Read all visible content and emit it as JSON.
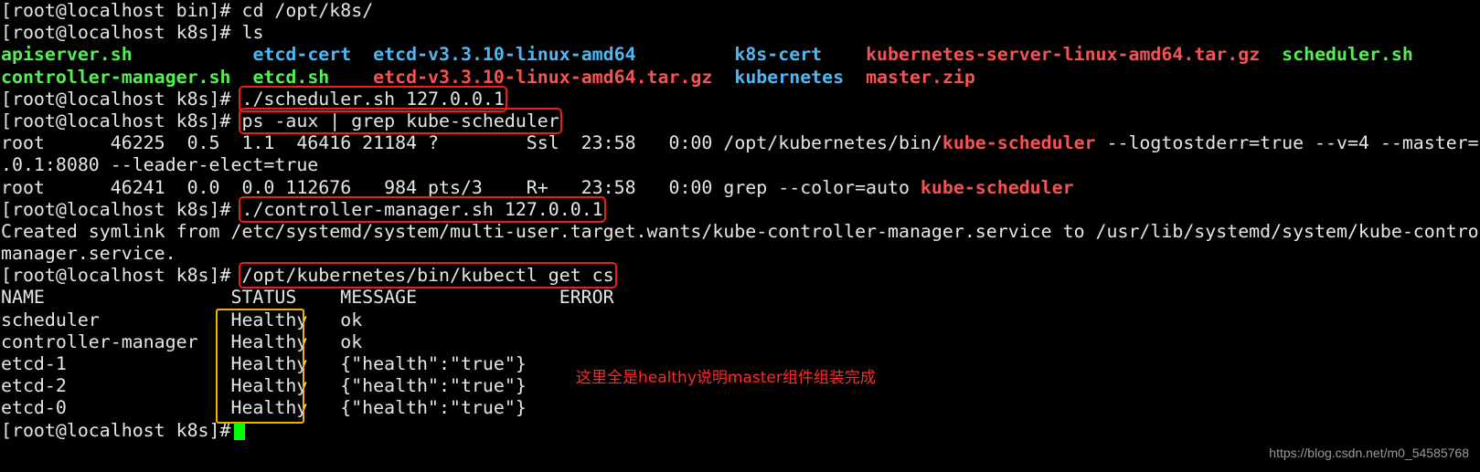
{
  "colors": {
    "green": "#55ee55",
    "blue": "#4db8f5",
    "red": "#f55353",
    "highlight_box": "#ee1c1c",
    "status_box": "#f5b100",
    "cursor": "#00ff00"
  },
  "terminal": {
    "lines": [
      {
        "segments": [
          {
            "text": "[root@localhost bin]# ",
            "color": "default"
          },
          {
            "text": "cd /opt/k8s/",
            "color": "default"
          }
        ]
      },
      {
        "segments": [
          {
            "text": "[root@localhost k8s]# ",
            "color": "default"
          },
          {
            "text": "ls",
            "color": "default"
          }
        ]
      },
      {
        "segments": [
          {
            "text": "apiserver.sh",
            "color": "green"
          },
          {
            "text": "           ",
            "color": "default"
          },
          {
            "text": "etcd-cert",
            "color": "blue"
          },
          {
            "text": "  ",
            "color": "default"
          },
          {
            "text": "etcd-v3.3.10-linux-amd64",
            "color": "blue"
          },
          {
            "text": "         ",
            "color": "default"
          },
          {
            "text": "k8s-cert",
            "color": "blue"
          },
          {
            "text": "    ",
            "color": "default"
          },
          {
            "text": "kubernetes-server-linux-amd64.tar.gz",
            "color": "redb"
          },
          {
            "text": "  ",
            "color": "default"
          },
          {
            "text": "scheduler.sh",
            "color": "green"
          }
        ]
      },
      {
        "segments": [
          {
            "text": "controller-manager.sh",
            "color": "green"
          },
          {
            "text": "  ",
            "color": "default"
          },
          {
            "text": "etcd.sh",
            "color": "green"
          },
          {
            "text": "    ",
            "color": "default"
          },
          {
            "text": "etcd-v3.3.10-linux-amd64.tar.gz",
            "color": "redb"
          },
          {
            "text": "  ",
            "color": "default"
          },
          {
            "text": "kubernetes",
            "color": "blue"
          },
          {
            "text": "  ",
            "color": "default"
          },
          {
            "text": "master.zip",
            "color": "redb"
          }
        ]
      },
      {
        "segments": [
          {
            "text": "[root@localhost k8s]# ",
            "color": "default"
          },
          {
            "text": "./scheduler.sh 127.0.0.1",
            "color": "default",
            "highlight": true
          }
        ]
      },
      {
        "segments": [
          {
            "text": "[root@localhost k8s]# ",
            "color": "default"
          },
          {
            "text": "ps -aux | grep kube-scheduler",
            "color": "default",
            "highlight": true
          }
        ]
      },
      {
        "segments": [
          {
            "text": "root      46225  0.5  1.1  46416 21184 ?        Ssl  23:58   0:00 /opt/kubernetes/bin/",
            "color": "default"
          },
          {
            "text": "kube-scheduler",
            "color": "redb"
          },
          {
            "text": " --logtostderr=true --v=4 --master=",
            "color": "default"
          }
        ]
      },
      {
        "segments": [
          {
            "text": ".0.1:8080 --leader-elect=true",
            "color": "default"
          }
        ]
      },
      {
        "segments": [
          {
            "text": "root      46241  0.0  0.0 112676   984 pts/3    R+   23:58   0:00 grep --color=auto ",
            "color": "default"
          },
          {
            "text": "kube-scheduler",
            "color": "redb"
          }
        ]
      },
      {
        "segments": [
          {
            "text": "[root@localhost k8s]# ",
            "color": "default"
          },
          {
            "text": "./controller-manager.sh 127.0.0.1",
            "color": "default",
            "highlight": true
          }
        ]
      },
      {
        "segments": [
          {
            "text": "Created symlink from /etc/systemd/system/multi-user.target.wants/kube-controller-manager.service to /usr/lib/systemd/system/kube-contro",
            "color": "default"
          }
        ]
      },
      {
        "segments": [
          {
            "text": "manager.service.",
            "color": "default"
          }
        ]
      },
      {
        "segments": [
          {
            "text": "[root@localhost k8s]# ",
            "color": "default"
          },
          {
            "text": "/opt/kubernetes/bin/kubectl get cs",
            "color": "default",
            "highlight": true
          }
        ]
      },
      {
        "segments": [
          {
            "text": "NAME                 STATUS    MESSAGE             ERROR",
            "color": "default"
          }
        ]
      },
      {
        "segments": [
          {
            "text": "scheduler            Healthy   ok",
            "color": "default"
          }
        ]
      },
      {
        "segments": [
          {
            "text": "controller-manager   Healthy   ok",
            "color": "default"
          }
        ]
      },
      {
        "segments": [
          {
            "text": "etcd-1               Healthy   {\"health\":\"true\"}",
            "color": "default"
          }
        ]
      },
      {
        "segments": [
          {
            "text": "etcd-2               Healthy   {\"health\":\"true\"}",
            "color": "default"
          }
        ]
      },
      {
        "segments": [
          {
            "text": "etcd-0               Healthy   {\"health\":\"true\"}",
            "color": "default"
          }
        ]
      },
      {
        "segments": [
          {
            "text": "[root@localhost k8s]# ",
            "color": "default"
          }
        ]
      }
    ]
  },
  "annotation": "这里全是healthy说明master组件组装完成",
  "watermark": "https://blog.csdn.net/m0_54585768"
}
